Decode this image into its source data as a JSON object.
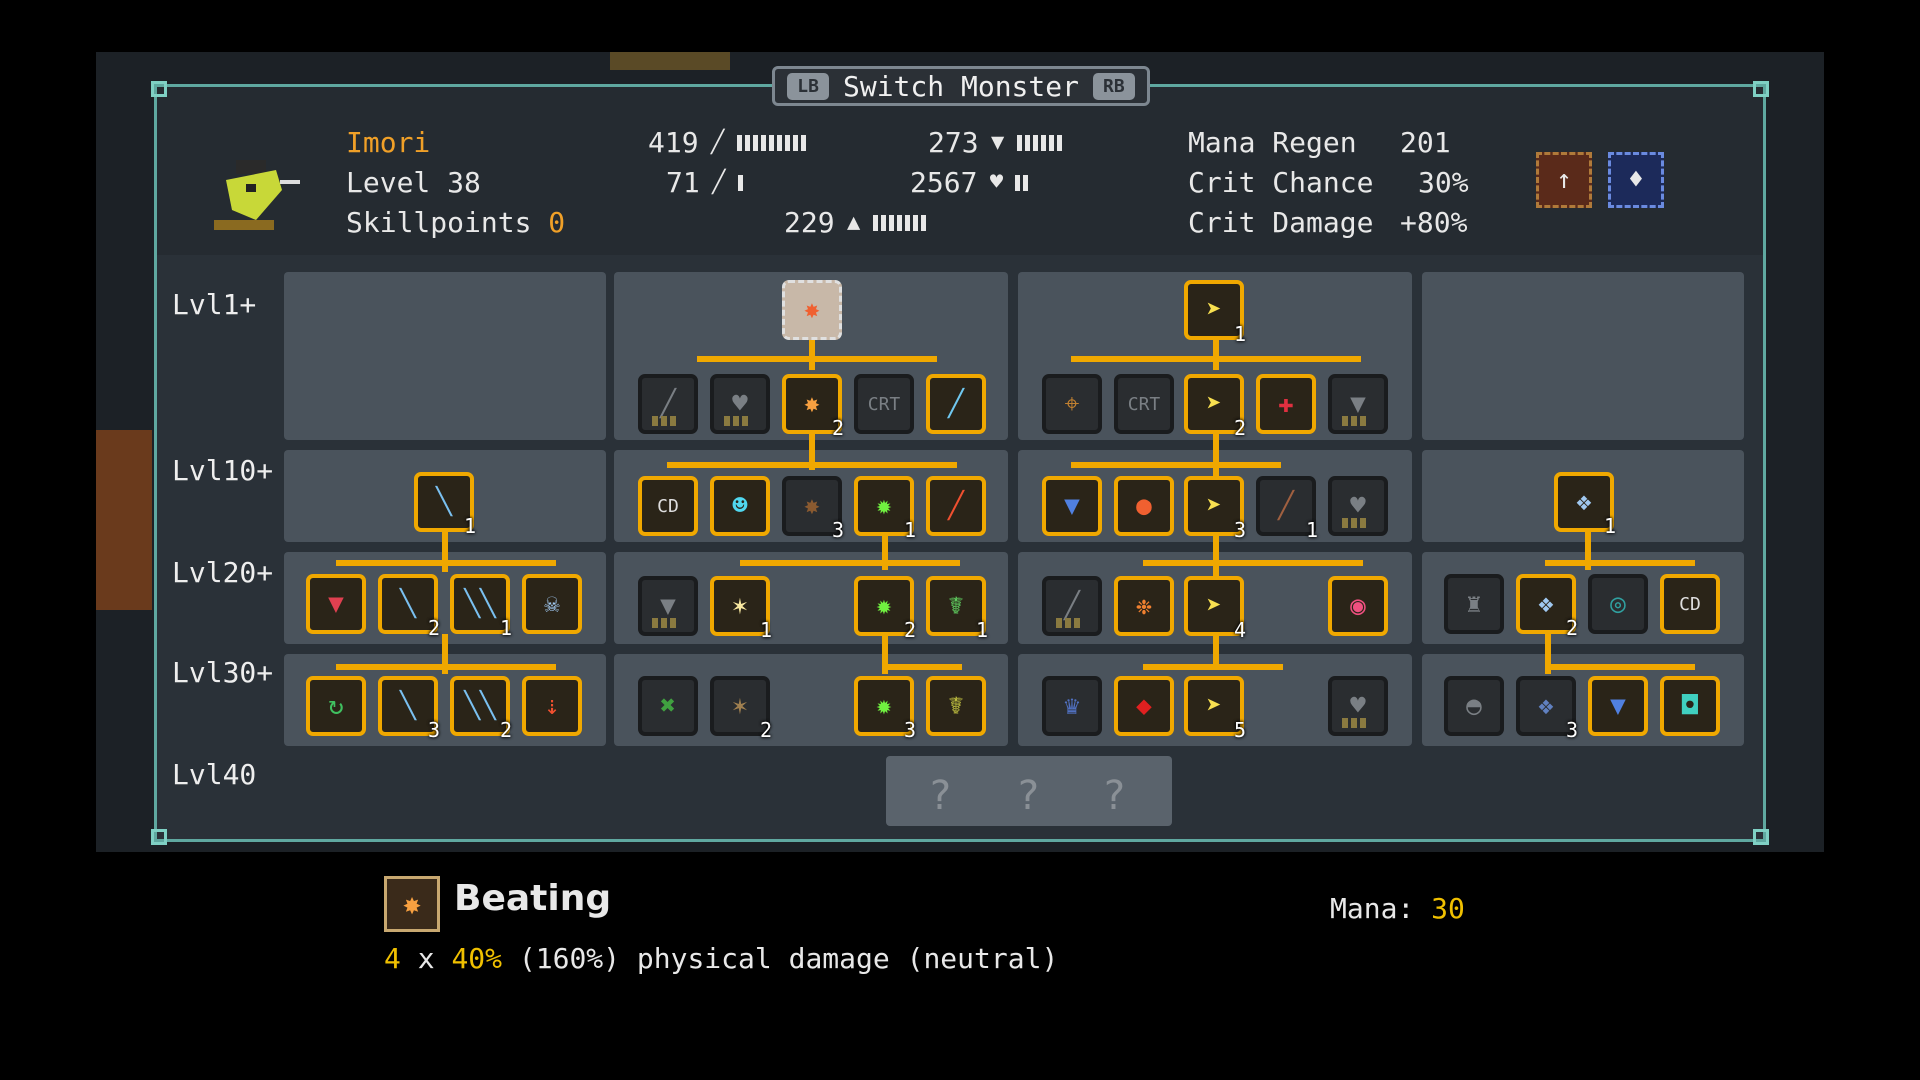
{
  "header": {
    "lb": "LB",
    "rb": "RB",
    "title": "Switch Monster"
  },
  "monster": {
    "name": "Imori",
    "level": "Level 38",
    "skillpoints_label": "Skillpoints",
    "skillpoints_value": "0",
    "stats": {
      "attack": "419",
      "magic": "71",
      "defense": "273",
      "health": "2567",
      "speed": "229"
    },
    "right_stats": [
      {
        "label": "Mana Regen",
        "value": "201"
      },
      {
        "label": "Crit Chance",
        "value": "30%"
      },
      {
        "label": "Crit Damage",
        "value": "+80%"
      }
    ]
  },
  "tree": {
    "rows": [
      "Lvl1+",
      "Lvl10+",
      "Lvl20+",
      "Lvl30+",
      "Lvl40"
    ],
    "counts": {
      "c1": "1",
      "c2": "2",
      "c3": "3",
      "c4": "4",
      "c5": "5"
    },
    "crt": "CRT",
    "cd": "CD",
    "unknown": "?"
  },
  "selected_skill": {
    "name": "Beating",
    "mana_label": "Mana:",
    "mana_value": "30",
    "desc_hits": "4",
    "desc_x": "x",
    "desc_pct": "40%",
    "desc_rest": "(160%) physical damage (neutral)"
  },
  "colors": {
    "accent": "#f0a800",
    "highlight": "#f0c000",
    "panel": "#2a3138",
    "border": "#5fa8a0"
  }
}
